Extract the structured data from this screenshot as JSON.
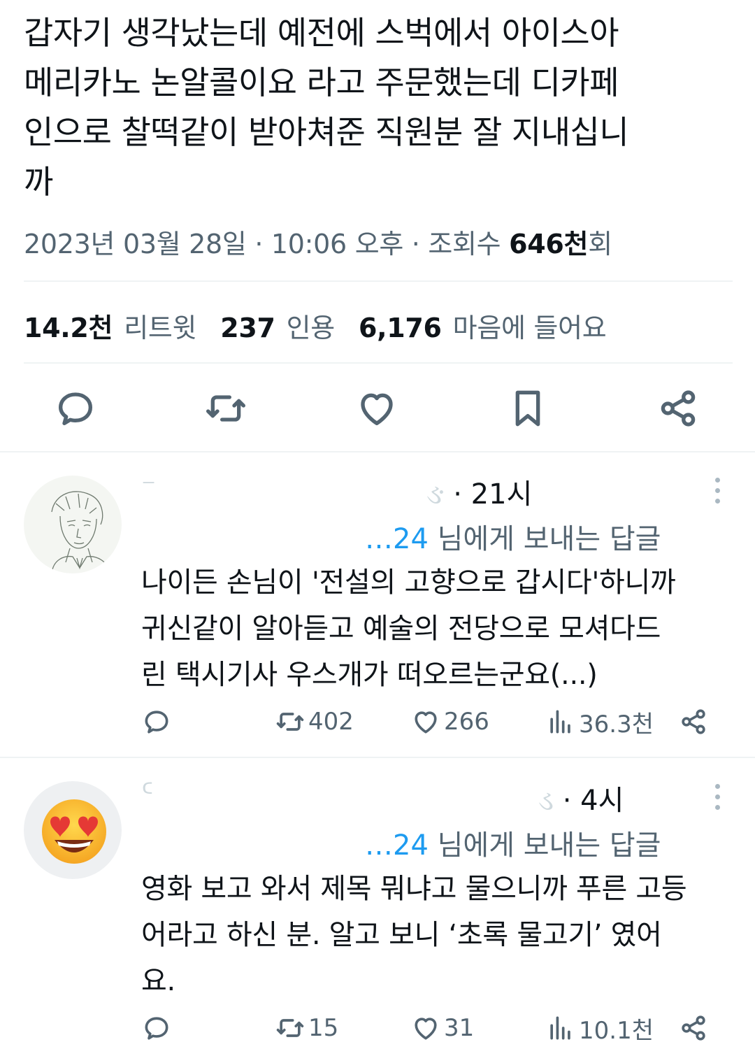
{
  "tweet": {
    "text": "갑자기 생각났는데 예전에 스벅에서 아이스아\n메리카노 논알콜이요 라고 주문했는데 디카페\n인으로 찰떡같이 받아쳐준 직원분 잘 지내십니\n까",
    "date": "2023년 03월 28일",
    "time": "10:06 오후",
    "views_label": "조회수",
    "views_value": "646천",
    "views_suffix": "회",
    "retweets_value": "14.2천",
    "retweets_label": "리트윗",
    "quotes_value": "237",
    "quotes_label": "인용",
    "likes_value": "6,176",
    "likes_label": "마음에 들어요"
  },
  "actions": {
    "reply_icon": "reply-icon",
    "retweet_icon": "retweet-icon",
    "like_icon": "heart-icon",
    "bookmark_icon": "bookmark-icon",
    "share_icon": "share-icon"
  },
  "replies": [
    {
      "name_visible": "⁻",
      "handle_visible": "ઙ",
      "time": "· 21시",
      "reply_to_handle": "…24",
      "reply_to_suffix": "님에게 보내는 답글",
      "text": "나이든 손님이 '전설의 고향으로 갑시다'하니까\n귀신같이 알아듣고 예술의 전당으로 모셔다드\n린 택시기사 우스개가 떠오르는군요(...)",
      "retweets": "402",
      "likes": "266",
      "views": "36.3천",
      "avatar": "sketch-man-avatar"
    },
    {
      "name_visible": "ᑦ",
      "handle_visible": "ડ",
      "time": "· 4시",
      "reply_to_handle": "…24",
      "reply_to_suffix": "님에게 보내는 답글",
      "text": "영화 보고 와서 제목 뭐냐고 물으니까 푸른 고등\n어라고 하신 분. 알고 보니 ‘초록 물고기’ 였어\n요.",
      "retweets": "15",
      "likes": "31",
      "views": "10.1천",
      "avatar": "heart-eyes-emoji-avatar"
    }
  ],
  "colors": {
    "link": "#1d9bf0",
    "muted": "#536471",
    "text": "#0f1419"
  }
}
